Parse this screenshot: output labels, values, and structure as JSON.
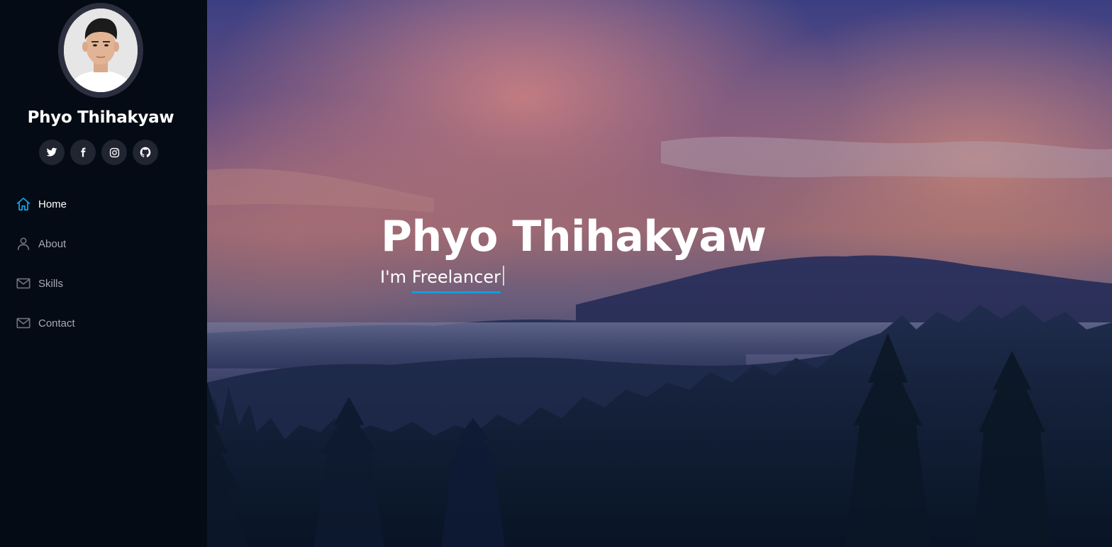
{
  "profile": {
    "name": "Phyo Thihakyaw",
    "avatar_icon": "profile-photo"
  },
  "social": [
    {
      "name": "twitter",
      "icon": "twitter-icon"
    },
    {
      "name": "facebook",
      "icon": "facebook-icon"
    },
    {
      "name": "instagram",
      "icon": "instagram-icon"
    },
    {
      "name": "github",
      "icon": "github-icon"
    }
  ],
  "nav": {
    "items": [
      {
        "label": "Home",
        "icon": "home-icon",
        "active": true
      },
      {
        "label": "About",
        "icon": "user-icon",
        "active": false
      },
      {
        "label": "Skills",
        "icon": "envelope-icon",
        "active": false
      },
      {
        "label": "Contact",
        "icon": "envelope-icon",
        "active": false
      }
    ]
  },
  "hero": {
    "title": "Phyo Thihakyaw",
    "prefix": "I'm",
    "typed": "Freelancer"
  },
  "colors": {
    "sidebar_bg": "#040b14",
    "social_bg": "#212431",
    "accent": "#149ddd",
    "nav_text": "#a8a9b4",
    "active_text": "#ffffff"
  }
}
